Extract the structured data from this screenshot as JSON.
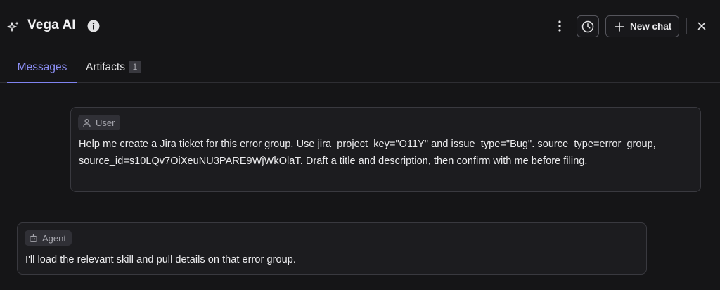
{
  "header": {
    "title": "Vega AI",
    "icons": [
      "sparkle-icon",
      "info-icon",
      "kebab-menu-icon",
      "history-clock-icon",
      "plus-icon",
      "close-icon"
    ],
    "new_chat_label": "New chat"
  },
  "tabs": [
    {
      "label": "Messages",
      "active": true
    },
    {
      "label": "Artifacts",
      "badge": "1",
      "active": false
    }
  ],
  "messages": [
    {
      "role": "User",
      "icon": "user-icon",
      "text": "Help me create a Jira ticket for this error group. Use jira_project_key=\"O11Y\" and issue_type=\"Bug\". source_type=error_group, source_id=s10LQv7OiXeuNU3PARE9WjWkOlaT. Draft a title and description, then confirm with me before filing."
    },
    {
      "role": "Agent",
      "icon": "robot-icon",
      "text": "I'll load the relevant skill and pull details on that error group."
    }
  ],
  "colors": {
    "background": "#151517",
    "accent": "#8c8ff5",
    "border": "#39393f"
  }
}
